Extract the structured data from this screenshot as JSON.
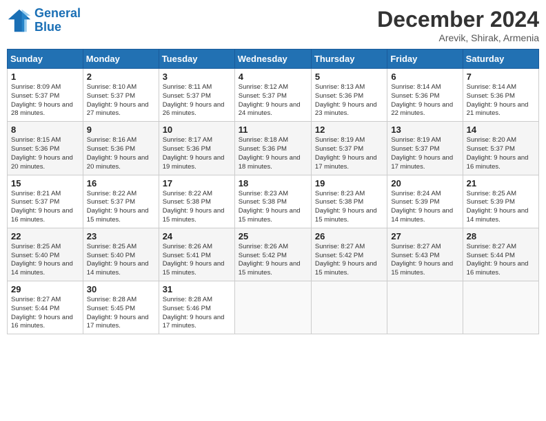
{
  "header": {
    "logo_line1": "General",
    "logo_line2": "Blue",
    "month": "December 2024",
    "location": "Arevik, Shirak, Armenia"
  },
  "days_of_week": [
    "Sunday",
    "Monday",
    "Tuesday",
    "Wednesday",
    "Thursday",
    "Friday",
    "Saturday"
  ],
  "weeks": [
    [
      {
        "day": "1",
        "sunrise": "Sunrise: 8:09 AM",
        "sunset": "Sunset: 5:37 PM",
        "daylight": "Daylight: 9 hours and 28 minutes."
      },
      {
        "day": "2",
        "sunrise": "Sunrise: 8:10 AM",
        "sunset": "Sunset: 5:37 PM",
        "daylight": "Daylight: 9 hours and 27 minutes."
      },
      {
        "day": "3",
        "sunrise": "Sunrise: 8:11 AM",
        "sunset": "Sunset: 5:37 PM",
        "daylight": "Daylight: 9 hours and 26 minutes."
      },
      {
        "day": "4",
        "sunrise": "Sunrise: 8:12 AM",
        "sunset": "Sunset: 5:37 PM",
        "daylight": "Daylight: 9 hours and 24 minutes."
      },
      {
        "day": "5",
        "sunrise": "Sunrise: 8:13 AM",
        "sunset": "Sunset: 5:36 PM",
        "daylight": "Daylight: 9 hours and 23 minutes."
      },
      {
        "day": "6",
        "sunrise": "Sunrise: 8:14 AM",
        "sunset": "Sunset: 5:36 PM",
        "daylight": "Daylight: 9 hours and 22 minutes."
      },
      {
        "day": "7",
        "sunrise": "Sunrise: 8:14 AM",
        "sunset": "Sunset: 5:36 PM",
        "daylight": "Daylight: 9 hours and 21 minutes."
      }
    ],
    [
      {
        "day": "8",
        "sunrise": "Sunrise: 8:15 AM",
        "sunset": "Sunset: 5:36 PM",
        "daylight": "Daylight: 9 hours and 20 minutes."
      },
      {
        "day": "9",
        "sunrise": "Sunrise: 8:16 AM",
        "sunset": "Sunset: 5:36 PM",
        "daylight": "Daylight: 9 hours and 20 minutes."
      },
      {
        "day": "10",
        "sunrise": "Sunrise: 8:17 AM",
        "sunset": "Sunset: 5:36 PM",
        "daylight": "Daylight: 9 hours and 19 minutes."
      },
      {
        "day": "11",
        "sunrise": "Sunrise: 8:18 AM",
        "sunset": "Sunset: 5:36 PM",
        "daylight": "Daylight: 9 hours and 18 minutes."
      },
      {
        "day": "12",
        "sunrise": "Sunrise: 8:19 AM",
        "sunset": "Sunset: 5:37 PM",
        "daylight": "Daylight: 9 hours and 17 minutes."
      },
      {
        "day": "13",
        "sunrise": "Sunrise: 8:19 AM",
        "sunset": "Sunset: 5:37 PM",
        "daylight": "Daylight: 9 hours and 17 minutes."
      },
      {
        "day": "14",
        "sunrise": "Sunrise: 8:20 AM",
        "sunset": "Sunset: 5:37 PM",
        "daylight": "Daylight: 9 hours and 16 minutes."
      }
    ],
    [
      {
        "day": "15",
        "sunrise": "Sunrise: 8:21 AM",
        "sunset": "Sunset: 5:37 PM",
        "daylight": "Daylight: 9 hours and 16 minutes."
      },
      {
        "day": "16",
        "sunrise": "Sunrise: 8:22 AM",
        "sunset": "Sunset: 5:37 PM",
        "daylight": "Daylight: 9 hours and 15 minutes."
      },
      {
        "day": "17",
        "sunrise": "Sunrise: 8:22 AM",
        "sunset": "Sunset: 5:38 PM",
        "daylight": "Daylight: 9 hours and 15 minutes."
      },
      {
        "day": "18",
        "sunrise": "Sunrise: 8:23 AM",
        "sunset": "Sunset: 5:38 PM",
        "daylight": "Daylight: 9 hours and 15 minutes."
      },
      {
        "day": "19",
        "sunrise": "Sunrise: 8:23 AM",
        "sunset": "Sunset: 5:38 PM",
        "daylight": "Daylight: 9 hours and 15 minutes."
      },
      {
        "day": "20",
        "sunrise": "Sunrise: 8:24 AM",
        "sunset": "Sunset: 5:39 PM",
        "daylight": "Daylight: 9 hours and 14 minutes."
      },
      {
        "day": "21",
        "sunrise": "Sunrise: 8:25 AM",
        "sunset": "Sunset: 5:39 PM",
        "daylight": "Daylight: 9 hours and 14 minutes."
      }
    ],
    [
      {
        "day": "22",
        "sunrise": "Sunrise: 8:25 AM",
        "sunset": "Sunset: 5:40 PM",
        "daylight": "Daylight: 9 hours and 14 minutes."
      },
      {
        "day": "23",
        "sunrise": "Sunrise: 8:25 AM",
        "sunset": "Sunset: 5:40 PM",
        "daylight": "Daylight: 9 hours and 14 minutes."
      },
      {
        "day": "24",
        "sunrise": "Sunrise: 8:26 AM",
        "sunset": "Sunset: 5:41 PM",
        "daylight": "Daylight: 9 hours and 15 minutes."
      },
      {
        "day": "25",
        "sunrise": "Sunrise: 8:26 AM",
        "sunset": "Sunset: 5:42 PM",
        "daylight": "Daylight: 9 hours and 15 minutes."
      },
      {
        "day": "26",
        "sunrise": "Sunrise: 8:27 AM",
        "sunset": "Sunset: 5:42 PM",
        "daylight": "Daylight: 9 hours and 15 minutes."
      },
      {
        "day": "27",
        "sunrise": "Sunrise: 8:27 AM",
        "sunset": "Sunset: 5:43 PM",
        "daylight": "Daylight: 9 hours and 15 minutes."
      },
      {
        "day": "28",
        "sunrise": "Sunrise: 8:27 AM",
        "sunset": "Sunset: 5:44 PM",
        "daylight": "Daylight: 9 hours and 16 minutes."
      }
    ],
    [
      {
        "day": "29",
        "sunrise": "Sunrise: 8:27 AM",
        "sunset": "Sunset: 5:44 PM",
        "daylight": "Daylight: 9 hours and 16 minutes."
      },
      {
        "day": "30",
        "sunrise": "Sunrise: 8:28 AM",
        "sunset": "Sunset: 5:45 PM",
        "daylight": "Daylight: 9 hours and 17 minutes."
      },
      {
        "day": "31",
        "sunrise": "Sunrise: 8:28 AM",
        "sunset": "Sunset: 5:46 PM",
        "daylight": "Daylight: 9 hours and 17 minutes."
      },
      null,
      null,
      null,
      null
    ]
  ]
}
